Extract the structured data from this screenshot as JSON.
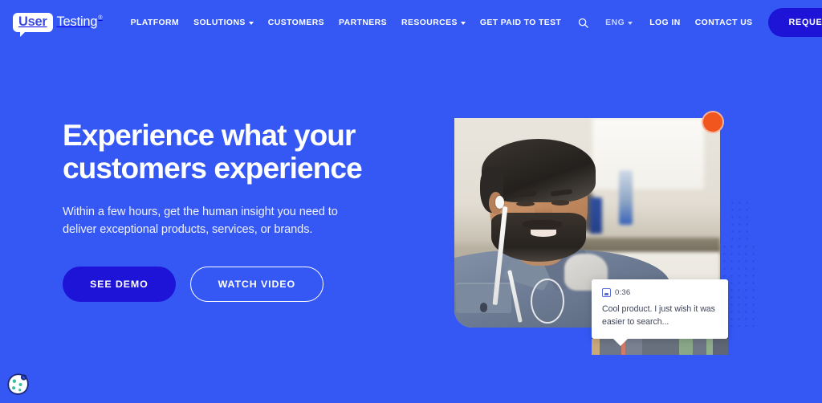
{
  "theme": {
    "bg_blue": "#3558F5",
    "button_dark_blue": "#1D14D8",
    "accent_orange": "#F0561D",
    "white": "#FFFFFF"
  },
  "nav": {
    "logo": {
      "bubble_text": "User",
      "word_text": "Testing",
      "trademark": "®"
    },
    "items": [
      {
        "label": "PLATFORM",
        "has_caret": false
      },
      {
        "label": "SOLUTIONS",
        "has_caret": true
      },
      {
        "label": "CUSTOMERS",
        "has_caret": false
      },
      {
        "label": "PARTNERS",
        "has_caret": false
      },
      {
        "label": "RESOURCES",
        "has_caret": true
      },
      {
        "label": "GET PAID TO TEST",
        "has_caret": false
      }
    ],
    "search_icon": "search-icon",
    "language": "ENG",
    "login_label": "LOG IN",
    "contact_label": "CONTACT US",
    "trial_button": "REQUEST TRIAL"
  },
  "hero": {
    "headline_line1": "Experience what your",
    "headline_line2": "customers experience",
    "subhead_line1": "Within a few hours, get the human insight you need to",
    "subhead_line2": "deliver exceptional products, services, or brands.",
    "primary_cta": "SEE DEMO",
    "secondary_cta": "WATCH VIDEO"
  },
  "media": {
    "record_indicator": "recording-dot",
    "alt": "Man with earbuds smiling during a remote user test session",
    "comment": {
      "timestamp": "0:36",
      "icon": "video-frame-icon",
      "text": "Cool product. I just wish it was easier to search..."
    },
    "timeline_segments": [
      {
        "color": "#c9a87a",
        "width": 6
      },
      {
        "color": "#6e7787",
        "width": 16
      },
      {
        "color": "#d07a6a",
        "width": 3
      },
      {
        "color": "#7a8292",
        "width": 12
      },
      {
        "color": "#69717f",
        "width": 27
      },
      {
        "color": "#8aa888",
        "width": 10
      },
      {
        "color": "#6e7787",
        "width": 10
      },
      {
        "color": "#8fae8b",
        "width": 5
      },
      {
        "color": "#5f6675",
        "width": 11
      }
    ]
  },
  "cookie_widget": {
    "icon": "cookie-icon",
    "label": "Cookie preferences"
  }
}
